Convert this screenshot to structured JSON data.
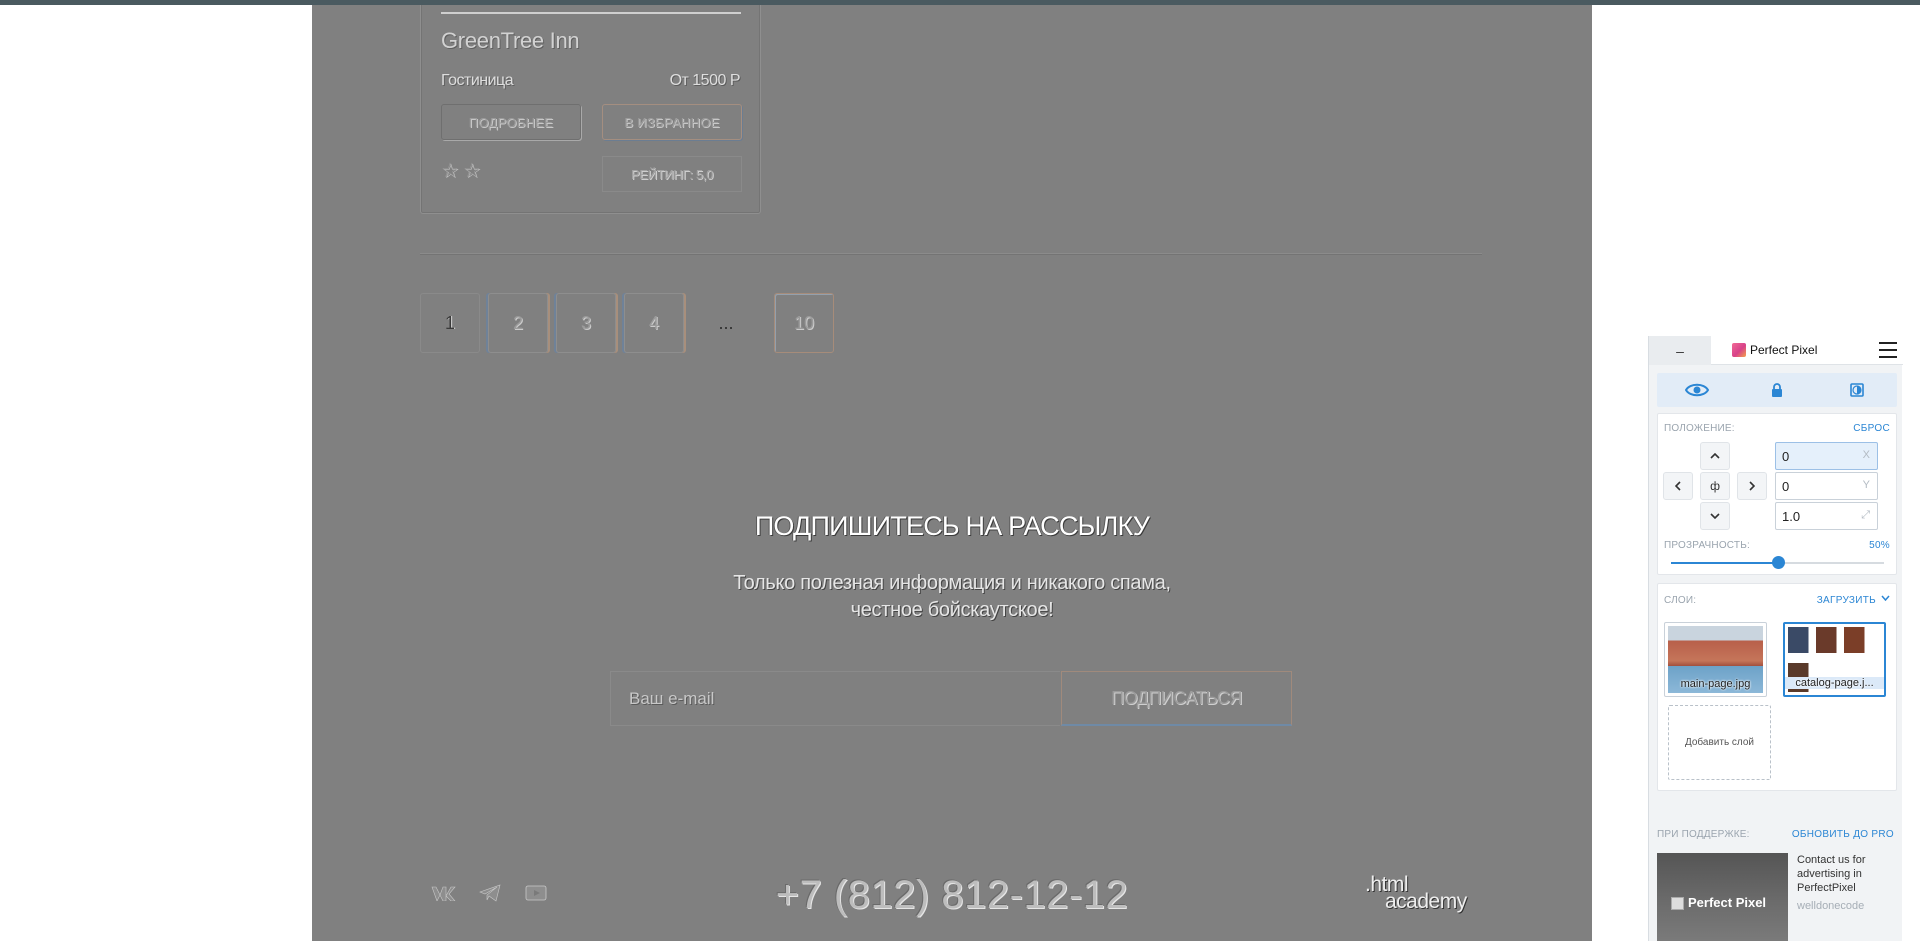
{
  "card": {
    "title": "GreenTree Inn",
    "type": "Гостиница",
    "price": "От 1500 Р",
    "more_label": "ПОДРОБНЕЕ",
    "fav_label": "В ИЗБРАННОЕ",
    "stars": "☆☆",
    "rating": "РЕЙТИНГ: 5,0"
  },
  "pagination": {
    "pages": [
      "1",
      "2",
      "3",
      "4",
      "...",
      "10"
    ]
  },
  "subscribe": {
    "title": "ПОДПИШИТЕСЬ НА РАССЫЛКУ",
    "text_line1": "Только полезная информация и никакого спама,",
    "text_line2": "честное бойскаутское!",
    "email_placeholder": "Ваш e-mail",
    "button_label": "ПОДПИСАТЬСЯ"
  },
  "footer": {
    "phone": "+7 (812) 812-12-12",
    "academy_line1": ".html",
    "academy_line2": "academy",
    "social_icons": [
      "vk-icon",
      "telegram-icon",
      "youtube-icon"
    ]
  },
  "perfect_pixel": {
    "minimize_label": "–",
    "title": "Perfect Pixel",
    "position_label": "ПОЛОЖЕНИЕ:",
    "reset_label": "СБРОС",
    "center_glyph": "ф",
    "x_value": "0",
    "x_axis": "X",
    "y_value": "0",
    "y_axis": "Y",
    "scale_value": "1.0",
    "opacity_label": "ПРОЗРАЧНОСТЬ:",
    "opacity_value": "50%",
    "opacity_fraction": 0.5,
    "layers_label": "СЛОИ:",
    "upload_label": "ЗАГРУЗИТЬ",
    "layers": [
      {
        "name": "main-page.jpg",
        "selected": false
      },
      {
        "name": "catalog-page.j...",
        "selected": true
      }
    ],
    "add_layer_label": "Добавить слой",
    "support_label": "ПРИ ПОДДЕРЖКЕ:",
    "upgrade_label": "ОБНОВИТЬ ДО PRO",
    "ad_brand": "Perfect Pixel",
    "ad_text": "Contact us for advertising in PerfectPixel",
    "ad_author": "welldonecode",
    "accent_color": "#2b86d4"
  }
}
